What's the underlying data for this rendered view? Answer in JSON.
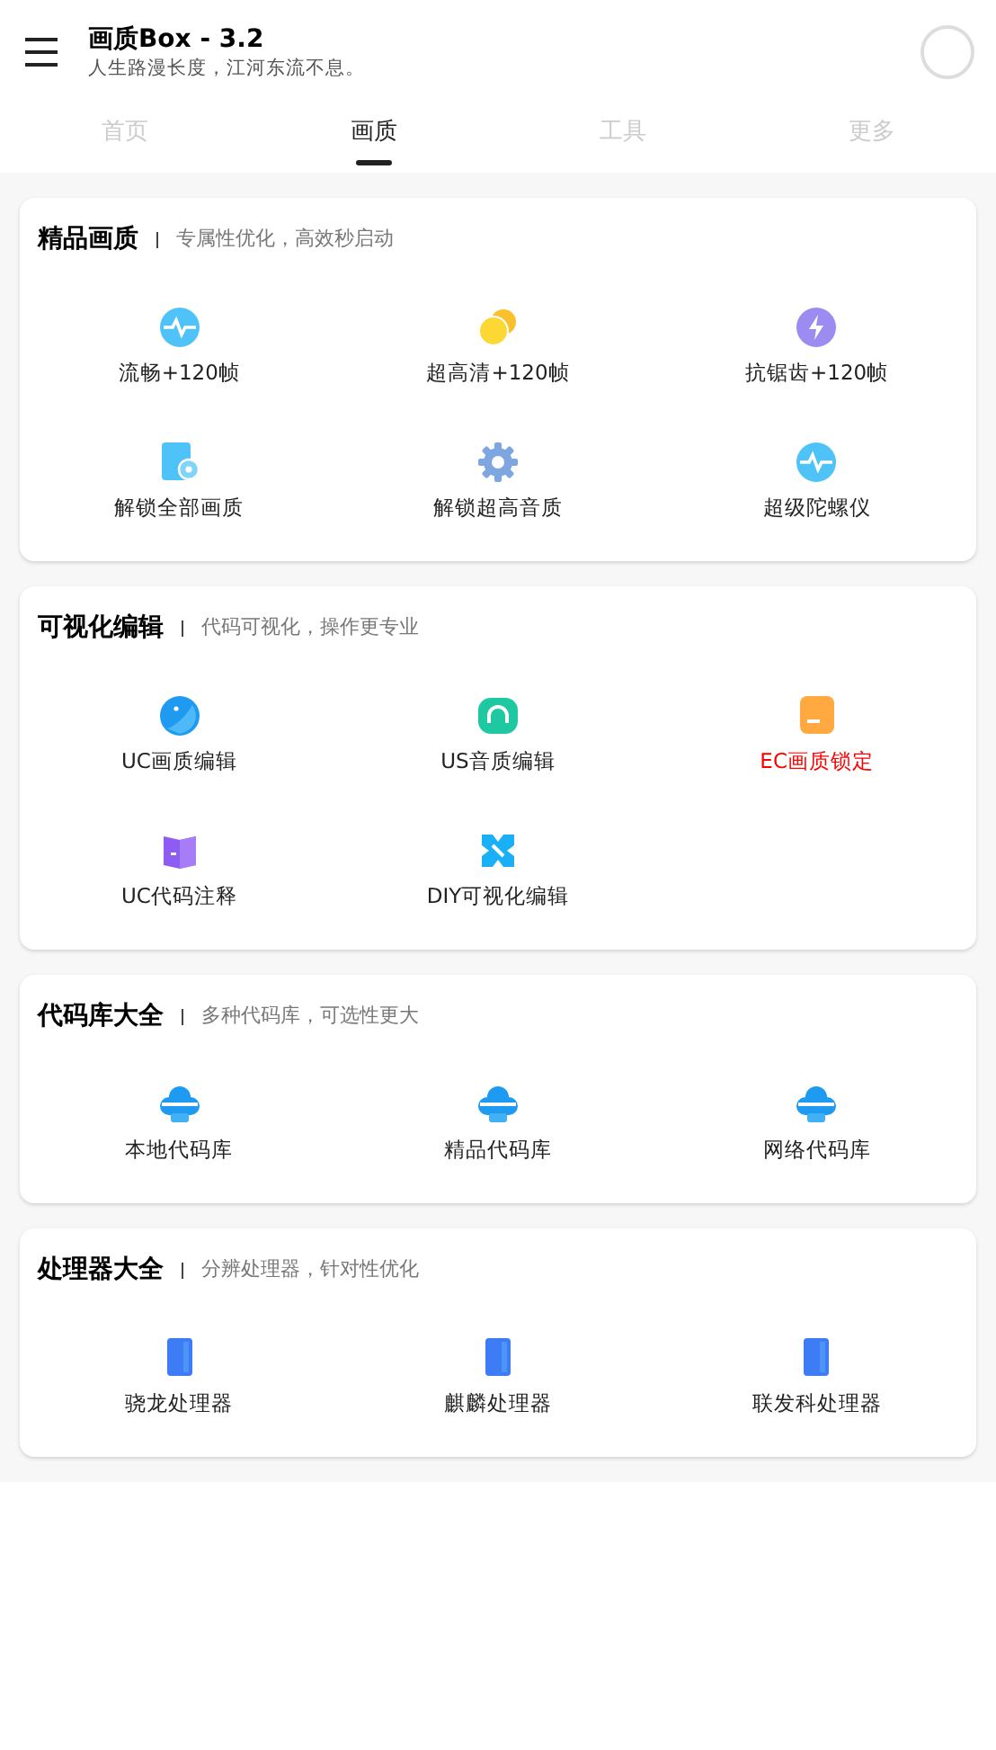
{
  "app_bar": {
    "title": "画质Box - 3.2",
    "subtitle": "人生路漫长度，江河东流不息。"
  },
  "tabs": [
    {
      "label": "首页",
      "selected": false
    },
    {
      "label": "画质",
      "selected": true
    },
    {
      "label": "工具",
      "selected": false
    },
    {
      "label": "更多",
      "selected": false
    }
  ],
  "sections": [
    {
      "title": "精品画质",
      "subtitle": "专属性优化，高效秒启动",
      "items": [
        {
          "label": "流畅+120帧",
          "kind": "pulse",
          "highlight": false
        },
        {
          "label": "超高清+120帧",
          "kind": "coins",
          "highlight": false
        },
        {
          "label": "抗锯齿+120帧",
          "kind": "bolt",
          "highlight": false
        },
        {
          "label": "解锁全部画质",
          "kind": "filepin",
          "highlight": false
        },
        {
          "label": "解锁超高音质",
          "kind": "gear",
          "highlight": false
        },
        {
          "label": "超级陀螺仪",
          "kind": "pulse",
          "highlight": false
        }
      ]
    },
    {
      "title": "可视化编辑",
      "subtitle": "代码可视化，操作更专业",
      "items": [
        {
          "label": "UC画质编辑",
          "kind": "globe",
          "highlight": false
        },
        {
          "label": "US音质编辑",
          "kind": "headphones",
          "highlight": false
        },
        {
          "label": "EC画质锁定",
          "kind": "drive",
          "highlight": true
        },
        {
          "label": "UC代码注释",
          "kind": "book",
          "highlight": false
        },
        {
          "label": "DIY可视化编辑",
          "kind": "cross",
          "highlight": false
        }
      ]
    },
    {
      "title": "代码库大全",
      "subtitle": "多种代码库，可选性更大",
      "items": [
        {
          "label": "本地代码库",
          "kind": "cloud",
          "highlight": false
        },
        {
          "label": "精品代码库",
          "kind": "cloud",
          "highlight": false
        },
        {
          "label": "网络代码库",
          "kind": "cloud",
          "highlight": false
        }
      ]
    },
    {
      "title": "处理器大全",
      "subtitle": "分辨处理器，针对性优化",
      "items": [
        {
          "label": "骁龙处理器",
          "kind": "tablet",
          "highlight": false
        },
        {
          "label": "麒麟处理器",
          "kind": "tablet",
          "highlight": false
        },
        {
          "label": "联发科处理器",
          "kind": "tablet",
          "highlight": false
        }
      ]
    }
  ]
}
